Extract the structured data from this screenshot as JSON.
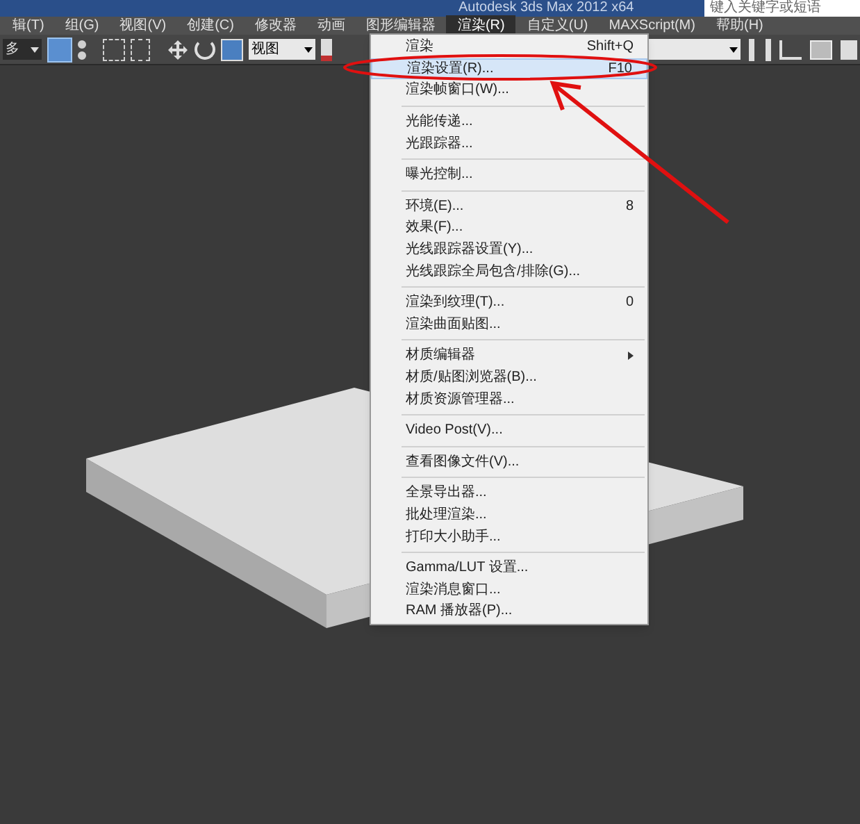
{
  "window": {
    "title": "Autodesk 3ds Max  2012 x64",
    "search": {
      "placeholder": "键入关键字或短语"
    }
  },
  "menubar": [
    {
      "label": "辑(T)",
      "selected": false
    },
    {
      "label": "组(G)",
      "selected": false
    },
    {
      "label": "视图(V)",
      "selected": false
    },
    {
      "label": "创建(C)",
      "selected": false
    },
    {
      "label": "修改器",
      "selected": false
    },
    {
      "label": "动画",
      "selected": false
    },
    {
      "label": "图形编辑器",
      "selected": false
    },
    {
      "label": "渲染(R)",
      "selected": true
    },
    {
      "label": "自定义(U)",
      "selected": false
    },
    {
      "label": "MAXScript(M)",
      "selected": false
    },
    {
      "label": "帮助(H)",
      "selected": false
    }
  ],
  "toolbar": {
    "selection_dropdown": "多",
    "view_dropdown": "视图"
  },
  "menu": [
    {
      "kind": "item",
      "label": "渲染",
      "shortcut": "Shift+Q",
      "selected": false
    },
    {
      "kind": "item",
      "label": "渲染设置(R)...",
      "shortcut": "F10",
      "selected": true
    },
    {
      "kind": "item",
      "label": "渲染帧窗口(W)...",
      "selected": false
    },
    {
      "kind": "separator"
    },
    {
      "kind": "item",
      "label": "光能传递...",
      "selected": false
    },
    {
      "kind": "item",
      "label": "光跟踪器...",
      "selected": false
    },
    {
      "kind": "separator"
    },
    {
      "kind": "item",
      "label": "曝光控制...",
      "selected": false
    },
    {
      "kind": "separator"
    },
    {
      "kind": "item",
      "label": "环境(E)...",
      "shortcut": "8",
      "selected": false
    },
    {
      "kind": "item",
      "label": "效果(F)...",
      "selected": false
    },
    {
      "kind": "item",
      "label": "光线跟踪器设置(Y)...",
      "selected": false
    },
    {
      "kind": "item",
      "label": "光线跟踪全局包含/排除(G)...",
      "selected": false
    },
    {
      "kind": "separator"
    },
    {
      "kind": "item",
      "label": "渲染到纹理(T)...",
      "shortcut": "0",
      "selected": false
    },
    {
      "kind": "item",
      "label": "渲染曲面贴图...",
      "selected": false
    },
    {
      "kind": "separator"
    },
    {
      "kind": "item",
      "label": "材质编辑器",
      "submenu": true,
      "selected": false
    },
    {
      "kind": "item",
      "label": "材质/贴图浏览器(B)...",
      "selected": false
    },
    {
      "kind": "item",
      "label": "材质资源管理器...",
      "selected": false
    },
    {
      "kind": "separator"
    },
    {
      "kind": "item",
      "label": "Video Post(V)...",
      "selected": false
    },
    {
      "kind": "separator"
    },
    {
      "kind": "item",
      "label": "查看图像文件(V)...",
      "selected": false
    },
    {
      "kind": "separator"
    },
    {
      "kind": "item",
      "label": "全景导出器...",
      "selected": false
    },
    {
      "kind": "item",
      "label": "批处理渲染...",
      "selected": false
    },
    {
      "kind": "item",
      "label": "打印大小助手...",
      "selected": false
    },
    {
      "kind": "separator"
    },
    {
      "kind": "item",
      "label": "Gamma/LUT 设置...",
      "selected": false
    },
    {
      "kind": "item",
      "label": "渲染消息窗口...",
      "selected": false
    },
    {
      "kind": "item",
      "label": "RAM 播放器(P)...",
      "selected": false
    }
  ]
}
